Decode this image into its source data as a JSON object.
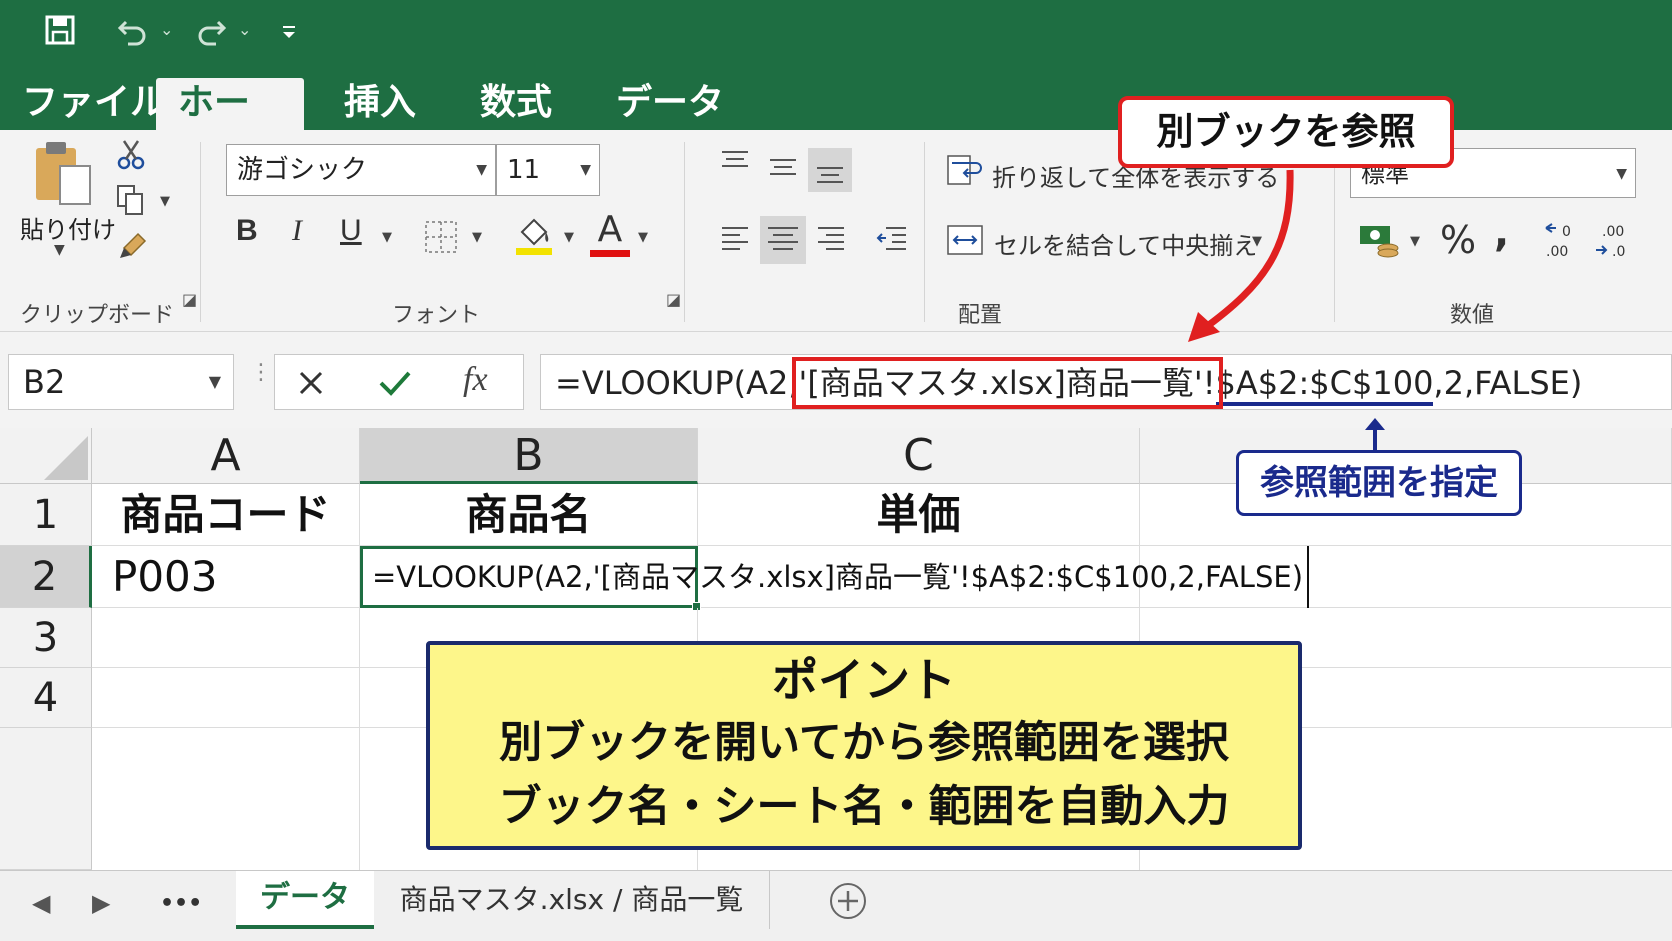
{
  "tabs": [
    "ファイル",
    "ホーム",
    "挿入",
    "数式",
    "データ"
  ],
  "clipboard": {
    "paste_label": "貼り付け",
    "group_label": "クリップボード"
  },
  "font": {
    "name": "游ゴシック",
    "size": "11",
    "group_label": "フォント",
    "bold": "B",
    "italic": "I",
    "underline": "U",
    "font_color_letter": "A"
  },
  "alignment": {
    "wrap_label": "折り返して全体を表示する",
    "merge_label": "セルを結合して中央揃え",
    "group_label": "配置"
  },
  "number": {
    "format": "標準",
    "percent": "%",
    "comma": ",",
    "group_label": "数値"
  },
  "formula_bar": {
    "name_box": "B2",
    "fx": "fx",
    "formula_prefix": "=VLOOKUP(A2,",
    "formula_book": "'[商品マスタ.xlsx]商品一覧'!",
    "formula_range": "$A$2:$C$100",
    "formula_suffix": ",2,FALSE)"
  },
  "columns": [
    "A",
    "B",
    "C"
  ],
  "rows": [
    "1",
    "2",
    "3",
    "4"
  ],
  "cells": {
    "A1": "商品コード",
    "B1": "商品名",
    "C1": "単価",
    "A2": "P003",
    "B2": "=VLOOKUP(A2,'[商品マスタ.xlsx]商品一覧'!$A$2:$C$100,2,FALSE)"
  },
  "callouts": {
    "book_ref": "別ブックを参照",
    "range_ref": "参照範囲を指定",
    "point_title": "ポイント",
    "point_line1": "別ブックを開いてから参照範囲を選択",
    "point_line2": "ブック名・シート名・範囲を自動入力"
  },
  "sheet_tabs": {
    "active": "データ",
    "other": "商品マスタ.xlsx / 商品一覧",
    "more": "•••"
  },
  "colors": {
    "excel_green": "#1e6e42",
    "callout_red": "#e02020",
    "callout_navy": "#1a2a8c",
    "point_bg": "#fdf68a"
  }
}
